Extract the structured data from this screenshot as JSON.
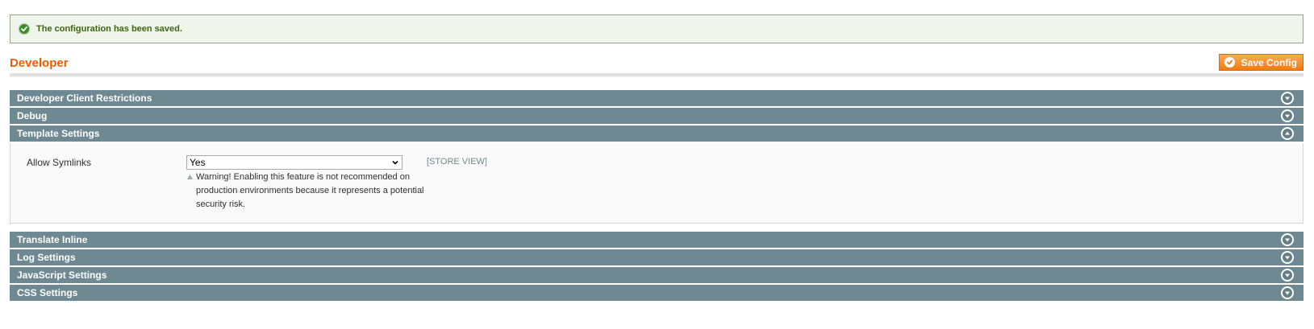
{
  "message": {
    "text": "The configuration has been saved.",
    "icon": "success-check-icon",
    "color": "#3d6611"
  },
  "header": {
    "title": "Developer",
    "save_label": "Save Config",
    "save_icon": "checkmark-icon",
    "accent": "#eb5e00"
  },
  "sections": [
    {
      "title": "Developer Client Restrictions",
      "expanded": false
    },
    {
      "title": "Debug",
      "expanded": false
    },
    {
      "title": "Template Settings",
      "expanded": true
    },
    {
      "title": "Translate Inline",
      "expanded": false
    },
    {
      "title": "Log Settings",
      "expanded": false
    },
    {
      "title": "JavaScript Settings",
      "expanded": false
    },
    {
      "title": "CSS Settings",
      "expanded": false
    }
  ],
  "template_settings": {
    "allow_symlinks": {
      "label": "Allow Symlinks",
      "value": "Yes",
      "comment": "Warning! Enabling this feature is not recommended on production environments because it represents a potential security risk.",
      "scope": "[STORE VIEW]"
    }
  },
  "colors": {
    "section_header": "#6f8992",
    "success_bg": "#eff5ea",
    "button": "#f07b0e"
  }
}
